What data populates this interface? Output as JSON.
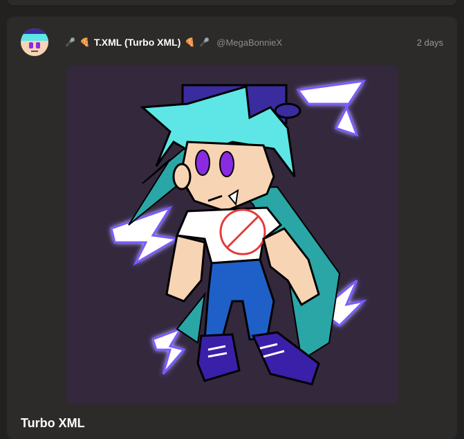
{
  "post": {
    "display_name": "T.XML (Turbo XML)",
    "handle": "@MegaBonnieX",
    "time": "2 days",
    "title": "Turbo XML",
    "icons": [
      "microphone-icon",
      "pizza-icon",
      "pizza-icon",
      "microphone-icon"
    ]
  },
  "colors": {
    "background": "#222120",
    "card": "#2c2b2a",
    "image_bg": "#34283d",
    "hair": "#5ee6e6",
    "cap": "#3a2c9e",
    "pants": "#1f5fc8",
    "lightning": "#ffffff",
    "glow": "#7a5cff",
    "no_symbol": "#e23b3b"
  }
}
